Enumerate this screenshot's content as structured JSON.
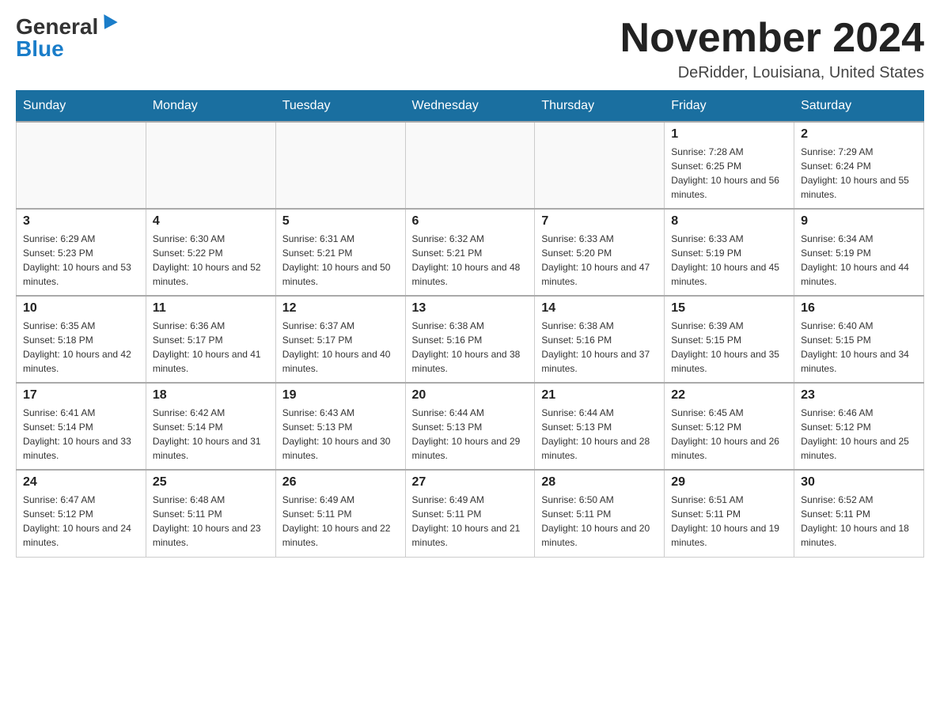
{
  "header": {
    "logo_general": "General",
    "logo_blue": "Blue",
    "title": "November 2024",
    "subtitle": "DeRidder, Louisiana, United States"
  },
  "days_of_week": [
    "Sunday",
    "Monday",
    "Tuesday",
    "Wednesday",
    "Thursday",
    "Friday",
    "Saturday"
  ],
  "weeks": [
    [
      {
        "day": "",
        "info": ""
      },
      {
        "day": "",
        "info": ""
      },
      {
        "day": "",
        "info": ""
      },
      {
        "day": "",
        "info": ""
      },
      {
        "day": "",
        "info": ""
      },
      {
        "day": "1",
        "info": "Sunrise: 7:28 AM\nSunset: 6:25 PM\nDaylight: 10 hours and 56 minutes."
      },
      {
        "day": "2",
        "info": "Sunrise: 7:29 AM\nSunset: 6:24 PM\nDaylight: 10 hours and 55 minutes."
      }
    ],
    [
      {
        "day": "3",
        "info": "Sunrise: 6:29 AM\nSunset: 5:23 PM\nDaylight: 10 hours and 53 minutes."
      },
      {
        "day": "4",
        "info": "Sunrise: 6:30 AM\nSunset: 5:22 PM\nDaylight: 10 hours and 52 minutes."
      },
      {
        "day": "5",
        "info": "Sunrise: 6:31 AM\nSunset: 5:21 PM\nDaylight: 10 hours and 50 minutes."
      },
      {
        "day": "6",
        "info": "Sunrise: 6:32 AM\nSunset: 5:21 PM\nDaylight: 10 hours and 48 minutes."
      },
      {
        "day": "7",
        "info": "Sunrise: 6:33 AM\nSunset: 5:20 PM\nDaylight: 10 hours and 47 minutes."
      },
      {
        "day": "8",
        "info": "Sunrise: 6:33 AM\nSunset: 5:19 PM\nDaylight: 10 hours and 45 minutes."
      },
      {
        "day": "9",
        "info": "Sunrise: 6:34 AM\nSunset: 5:19 PM\nDaylight: 10 hours and 44 minutes."
      }
    ],
    [
      {
        "day": "10",
        "info": "Sunrise: 6:35 AM\nSunset: 5:18 PM\nDaylight: 10 hours and 42 minutes."
      },
      {
        "day": "11",
        "info": "Sunrise: 6:36 AM\nSunset: 5:17 PM\nDaylight: 10 hours and 41 minutes."
      },
      {
        "day": "12",
        "info": "Sunrise: 6:37 AM\nSunset: 5:17 PM\nDaylight: 10 hours and 40 minutes."
      },
      {
        "day": "13",
        "info": "Sunrise: 6:38 AM\nSunset: 5:16 PM\nDaylight: 10 hours and 38 minutes."
      },
      {
        "day": "14",
        "info": "Sunrise: 6:38 AM\nSunset: 5:16 PM\nDaylight: 10 hours and 37 minutes."
      },
      {
        "day": "15",
        "info": "Sunrise: 6:39 AM\nSunset: 5:15 PM\nDaylight: 10 hours and 35 minutes."
      },
      {
        "day": "16",
        "info": "Sunrise: 6:40 AM\nSunset: 5:15 PM\nDaylight: 10 hours and 34 minutes."
      }
    ],
    [
      {
        "day": "17",
        "info": "Sunrise: 6:41 AM\nSunset: 5:14 PM\nDaylight: 10 hours and 33 minutes."
      },
      {
        "day": "18",
        "info": "Sunrise: 6:42 AM\nSunset: 5:14 PM\nDaylight: 10 hours and 31 minutes."
      },
      {
        "day": "19",
        "info": "Sunrise: 6:43 AM\nSunset: 5:13 PM\nDaylight: 10 hours and 30 minutes."
      },
      {
        "day": "20",
        "info": "Sunrise: 6:44 AM\nSunset: 5:13 PM\nDaylight: 10 hours and 29 minutes."
      },
      {
        "day": "21",
        "info": "Sunrise: 6:44 AM\nSunset: 5:13 PM\nDaylight: 10 hours and 28 minutes."
      },
      {
        "day": "22",
        "info": "Sunrise: 6:45 AM\nSunset: 5:12 PM\nDaylight: 10 hours and 26 minutes."
      },
      {
        "day": "23",
        "info": "Sunrise: 6:46 AM\nSunset: 5:12 PM\nDaylight: 10 hours and 25 minutes."
      }
    ],
    [
      {
        "day": "24",
        "info": "Sunrise: 6:47 AM\nSunset: 5:12 PM\nDaylight: 10 hours and 24 minutes."
      },
      {
        "day": "25",
        "info": "Sunrise: 6:48 AM\nSunset: 5:11 PM\nDaylight: 10 hours and 23 minutes."
      },
      {
        "day": "26",
        "info": "Sunrise: 6:49 AM\nSunset: 5:11 PM\nDaylight: 10 hours and 22 minutes."
      },
      {
        "day": "27",
        "info": "Sunrise: 6:49 AM\nSunset: 5:11 PM\nDaylight: 10 hours and 21 minutes."
      },
      {
        "day": "28",
        "info": "Sunrise: 6:50 AM\nSunset: 5:11 PM\nDaylight: 10 hours and 20 minutes."
      },
      {
        "day": "29",
        "info": "Sunrise: 6:51 AM\nSunset: 5:11 PM\nDaylight: 10 hours and 19 minutes."
      },
      {
        "day": "30",
        "info": "Sunrise: 6:52 AM\nSunset: 5:11 PM\nDaylight: 10 hours and 18 minutes."
      }
    ]
  ]
}
